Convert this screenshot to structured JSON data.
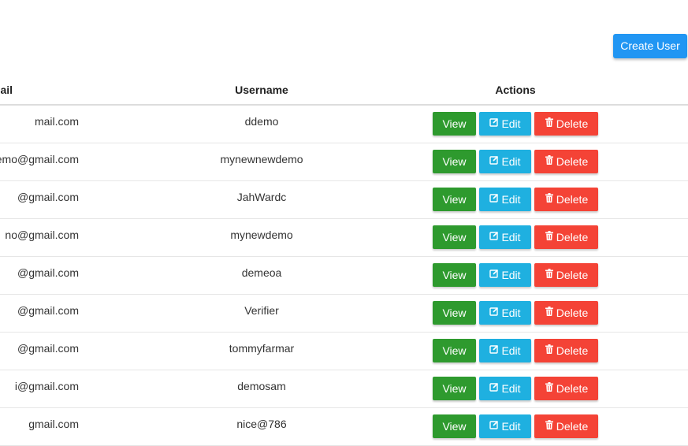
{
  "toolbar": {
    "create_user_label": "Create User"
  },
  "table": {
    "headers": {
      "email": "mail",
      "username": "Username",
      "actions": "Actions"
    },
    "buttons": {
      "view": "View",
      "edit": "Edit",
      "delete": "Delete"
    },
    "icons": {
      "edit": "edit-icon",
      "delete": "trash-icon"
    },
    "colors": {
      "create": "#2196f3",
      "view": "#2e9a2e",
      "edit": "#1fb0e0",
      "delete": "#f44336"
    },
    "rows": [
      {
        "email": "mail.com",
        "username": "ddemo"
      },
      {
        "email": "emo@gmail.com",
        "username": "mynewnewdemo"
      },
      {
        "email": "@gmail.com",
        "username": "JahWardc"
      },
      {
        "email": "no@gmail.com",
        "username": "mynewdemo"
      },
      {
        "email": "@gmail.com",
        "username": "demeoa"
      },
      {
        "email": "@gmail.com",
        "username": "Verifier"
      },
      {
        "email": "@gmail.com",
        "username": "tommyfarmar"
      },
      {
        "email": "i@gmail.com",
        "username": "demosam"
      },
      {
        "email": "gmail.com",
        "username": "nice@786"
      }
    ]
  }
}
